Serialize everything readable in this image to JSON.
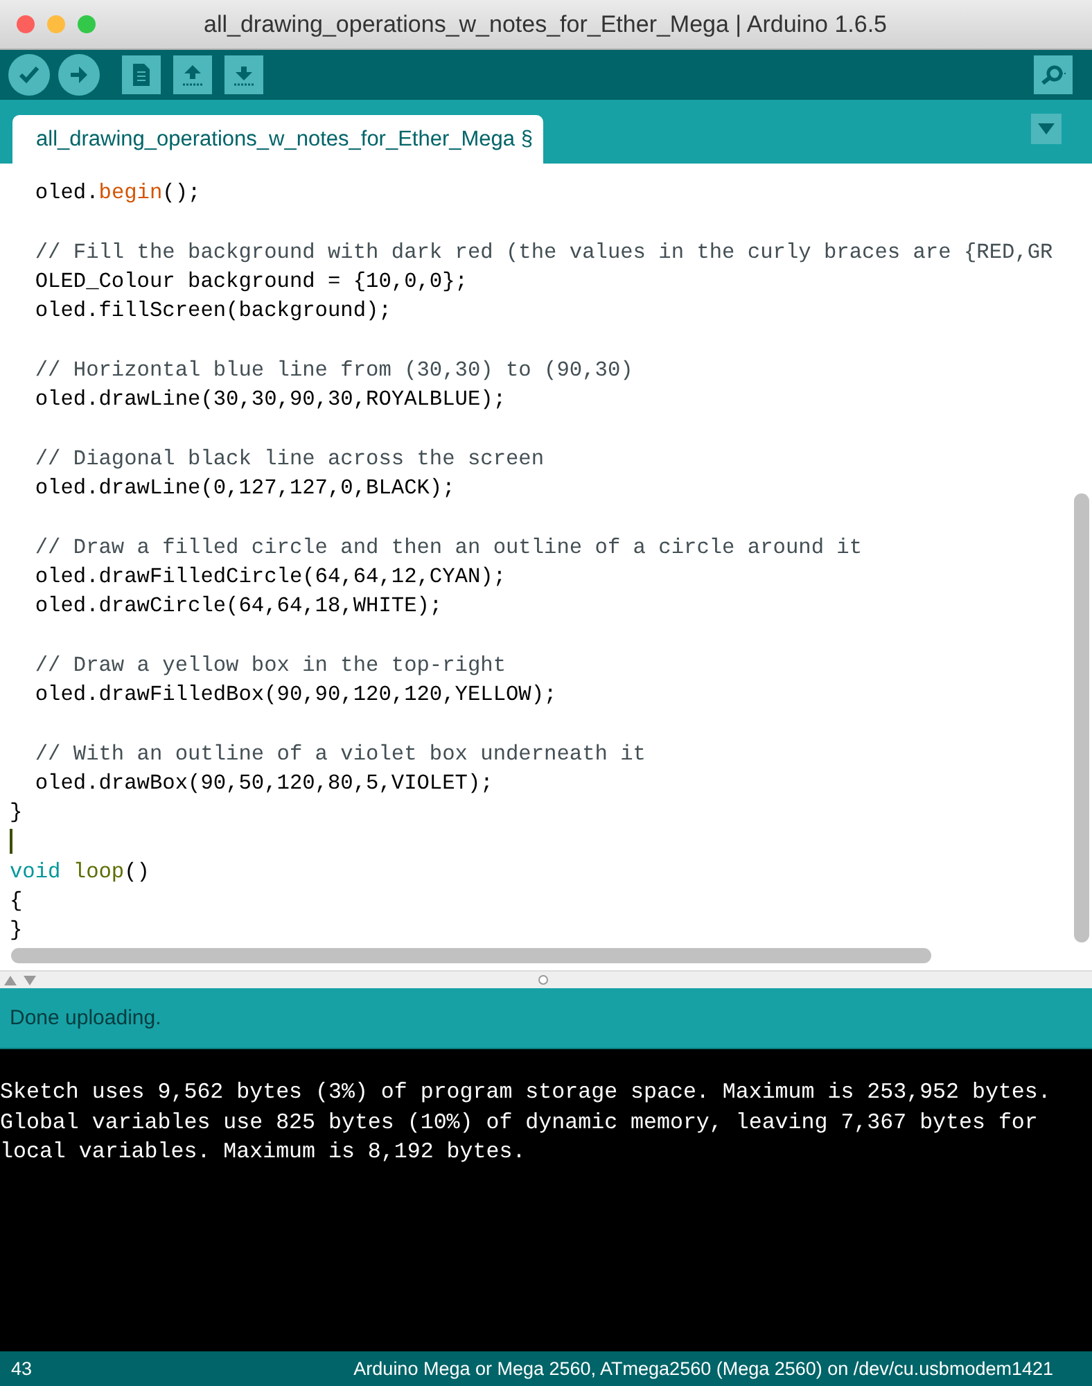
{
  "window": {
    "title": "all_drawing_operations_w_notes_for_Ether_Mega | Arduino 1.6.5"
  },
  "tabs": [
    {
      "label": "all_drawing_operations_w_notes_for_Ether_Mega §",
      "selected": true
    }
  ],
  "editor": {
    "lines": [
      {
        "kind": "code",
        "segments": [
          {
            "kind": "plain",
            "text": "  oled."
          },
          {
            "kind": "function",
            "text": "begin"
          },
          {
            "kind": "plain",
            "text": "();"
          }
        ]
      },
      {
        "kind": "blank"
      },
      {
        "kind": "code",
        "segments": [
          {
            "kind": "comment",
            "text": "  // Fill the background with dark red (the values in the curly braces are {RED,GR"
          }
        ]
      },
      {
        "kind": "code",
        "segments": [
          {
            "kind": "plain",
            "text": "  OLED_Colour background = {10,0,0};"
          }
        ]
      },
      {
        "kind": "code",
        "segments": [
          {
            "kind": "plain",
            "text": "  oled.fillScreen(background);"
          }
        ]
      },
      {
        "kind": "blank"
      },
      {
        "kind": "code",
        "segments": [
          {
            "kind": "comment",
            "text": "  // Horizontal blue line from (30,30) to (90,30)"
          }
        ]
      },
      {
        "kind": "code",
        "segments": [
          {
            "kind": "plain",
            "text": "  oled.drawLine(30,30,90,30,ROYALBLUE);"
          }
        ]
      },
      {
        "kind": "blank"
      },
      {
        "kind": "code",
        "segments": [
          {
            "kind": "comment",
            "text": "  // Diagonal black line across the screen"
          }
        ]
      },
      {
        "kind": "code",
        "segments": [
          {
            "kind": "plain",
            "text": "  oled.drawLine(0,127,127,0,BLACK);"
          }
        ]
      },
      {
        "kind": "blank"
      },
      {
        "kind": "code",
        "segments": [
          {
            "kind": "comment",
            "text": "  // Draw a filled circle and then an outline of a circle around it"
          }
        ]
      },
      {
        "kind": "code",
        "segments": [
          {
            "kind": "plain",
            "text": "  oled.drawFilledCircle(64,64,12,CYAN);"
          }
        ]
      },
      {
        "kind": "code",
        "segments": [
          {
            "kind": "plain",
            "text": "  oled.drawCircle(64,64,18,WHITE);"
          }
        ]
      },
      {
        "kind": "blank"
      },
      {
        "kind": "code",
        "segments": [
          {
            "kind": "comment",
            "text": "  // Draw a yellow box in the top-right"
          }
        ]
      },
      {
        "kind": "code",
        "segments": [
          {
            "kind": "plain",
            "text": "  oled.drawFilledBox(90,90,120,120,YELLOW);"
          }
        ]
      },
      {
        "kind": "blank"
      },
      {
        "kind": "code",
        "segments": [
          {
            "kind": "comment",
            "text": "  // With an outline of a violet box underneath it"
          }
        ]
      },
      {
        "kind": "code",
        "segments": [
          {
            "kind": "plain",
            "text": "  oled.drawBox(90,50,120,80,5,VIOLET);"
          }
        ]
      },
      {
        "kind": "code",
        "segments": [
          {
            "kind": "plain",
            "text": "}"
          }
        ]
      },
      {
        "kind": "blank",
        "caret": true
      },
      {
        "kind": "code",
        "segments": [
          {
            "kind": "keyword",
            "text": "void"
          },
          {
            "kind": "builtin",
            "text": " loop"
          },
          {
            "kind": "plain",
            "text": "()"
          }
        ]
      },
      {
        "kind": "code",
        "segments": [
          {
            "kind": "plain",
            "text": "{"
          }
        ]
      },
      {
        "kind": "code",
        "segments": [
          {
            "kind": "plain",
            "text": "}"
          }
        ]
      }
    ]
  },
  "status": {
    "message": "Done uploading."
  },
  "console": {
    "lines": [
      "Sketch uses 9,562 bytes (3%) of program storage space. Maximum is 253,952 bytes.",
      "Global variables use 825 bytes (10%) of dynamic memory, leaving 7,367 bytes for",
      "local variables. Maximum is 8,192 bytes."
    ]
  },
  "footer": {
    "line_number": "43",
    "board": "Arduino Mega or Mega 2560, ATmega2560 (Mega 2560) on /dev/cu.usbmodem1421"
  }
}
